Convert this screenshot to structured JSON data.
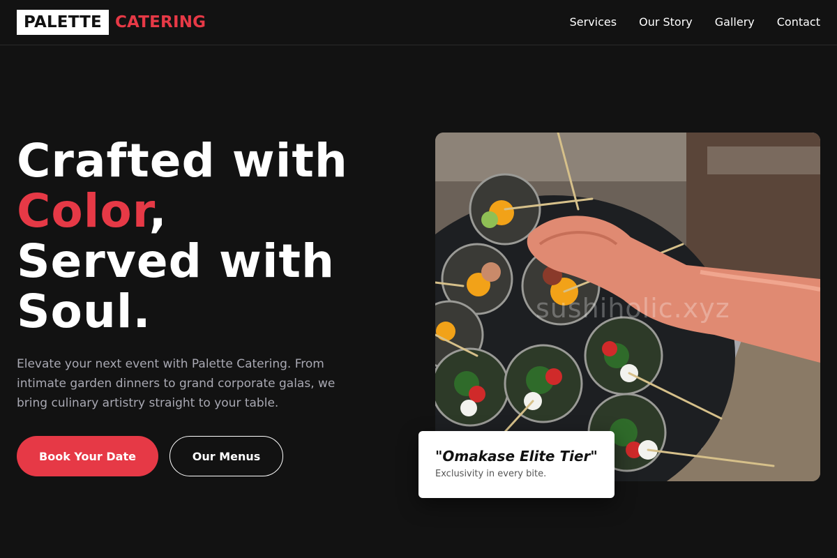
{
  "brand": {
    "logo_primary": "PALETTE",
    "logo_accent": "CATERING",
    "accent_color": "#e63946"
  },
  "nav": {
    "items": [
      {
        "label": "Services"
      },
      {
        "label": "Our Story"
      },
      {
        "label": "Gallery"
      },
      {
        "label": "Contact"
      }
    ]
  },
  "hero": {
    "headline_line1": "Crafted with",
    "headline_accent": "Color",
    "headline_comma": ",",
    "headline_line3": "Served with",
    "headline_line4": "Soul.",
    "lede": "Elevate your next event with Palette Catering. From intimate garden dinners to grand corporate galas, we bring culinary artistry straight to your table.",
    "primary_cta": "Book Your Date",
    "secondary_cta": "Our Menus"
  },
  "photo": {
    "watermark": "sushiholic.xyz",
    "subject": "catering-appetizer-cups-photo"
  },
  "quote_card": {
    "title": "\"Omakase Elite Tier\"",
    "subtitle": "Exclusivity in every bite."
  }
}
